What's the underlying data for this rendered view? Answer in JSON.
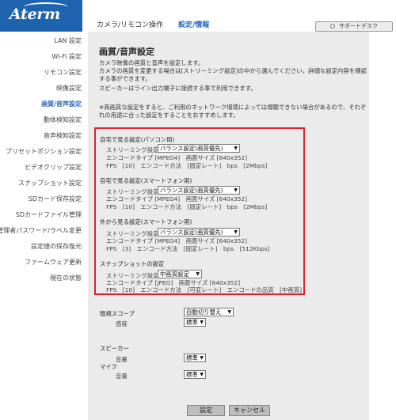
{
  "header": {
    "logo_text": "Aterm",
    "title": "カメラ/リモコン操作",
    "link": "設定/情報",
    "support_button": "サポートデスク"
  },
  "sidebar": {
    "items": [
      {
        "label": "LAN 設定"
      },
      {
        "label": "Wi-Fi 設定"
      },
      {
        "label": "リモコン設定"
      },
      {
        "label": "映像設定"
      },
      {
        "label": "画質/音声設定"
      },
      {
        "label": "動体検知設定"
      },
      {
        "label": "音声検知設定"
      },
      {
        "label": "プリセットポジション設定"
      },
      {
        "label": "ビデオクリップ設定"
      },
      {
        "label": "スナップショット設定"
      },
      {
        "label": "SDカード保存設定"
      },
      {
        "label": "SDカードファイル管理"
      },
      {
        "label": "管理者パスワード/ラベル変更"
      },
      {
        "label": "設定値の保存復元"
      },
      {
        "label": "ファームウェア更新"
      },
      {
        "label": "現在の状態"
      }
    ],
    "active_index": 4
  },
  "main": {
    "title": "画質/音声設定",
    "desc1": "カメラ映像の画質と音声を設定します。",
    "desc2": "カメラの画質を変更する場合は[ストリーミング設定]の中から選んでください。詳細な設定内容を確認する事ができます。",
    "desc3": "スピーカーはライン出力端子に接続する事で利用できます。",
    "desc4": "※高画質な設定をすると、ご利用のネットワーク環境によっては視聴できない場合があるので、それぞれの用途に合った設定をすることをおすすめします。",
    "sections": {
      "home_pc": {
        "title": "自宅で見る設定(パソコン用)",
        "streaming_label": "ストリーミング設定",
        "streaming_value": "バランス設定(画質優先)",
        "encode_line": "エンコードタイプ [MPEG4]　画面サイズ [640x352]",
        "fps_line": "FPS　[10]　エンコード方法　[固定レート]　bps　[2Mbps]"
      },
      "home_phone": {
        "title": "自宅で見る設定(スマートフォン用)",
        "streaming_label": "ストリーミング設定",
        "streaming_value": "バランス設定(画質優先)",
        "encode_line": "エンコードタイプ [MPEG4]　画面サイズ [640x352]",
        "fps_line": "FPS　[10]　エンコード方法　[固定レート]　bps　[2Mbps]"
      },
      "outside_phone": {
        "title": "外から見る設定(スマートフォン用)",
        "streaming_label": "ストリーミング設定",
        "streaming_value": "バランス設定(画質優先)",
        "encode_line": "エンコードタイプ [MPEG4]　画面サイズ [640x352]",
        "fps_line": "FPS　[3]　エンコード方法　[固定レート]　bps　[512Kbps]"
      },
      "snapshot": {
        "title": "スナップショットの設定",
        "streaming_label": "ストリーミング設定",
        "streaming_value": "中画質設定",
        "encode_line": "エンコードタイプ [JPEG]　画面サイズ [640x352]",
        "fps_line": "FPS　[10]　エンコード方法　[可変レート]　エンコードの品質　[中画質]"
      }
    },
    "scope_label": "暗視スコープ",
    "scope_value": "自動切り替え",
    "sensitivity_label": "感度",
    "sensitivity_value": "標準",
    "speaker_label": "スピーカー",
    "speaker_volume_label": "音量",
    "speaker_volume_value": "標準",
    "mic_label": "マイク",
    "mic_volume_label": "音量",
    "mic_volume_value": "標準",
    "save_button": "設定",
    "cancel_button": "キャンセル"
  },
  "colors": {
    "logo_bg": "#1e63ad",
    "accent": "#2b67b5",
    "highlight_border": "#e0212b",
    "panel_bg": "#ebebeb"
  }
}
